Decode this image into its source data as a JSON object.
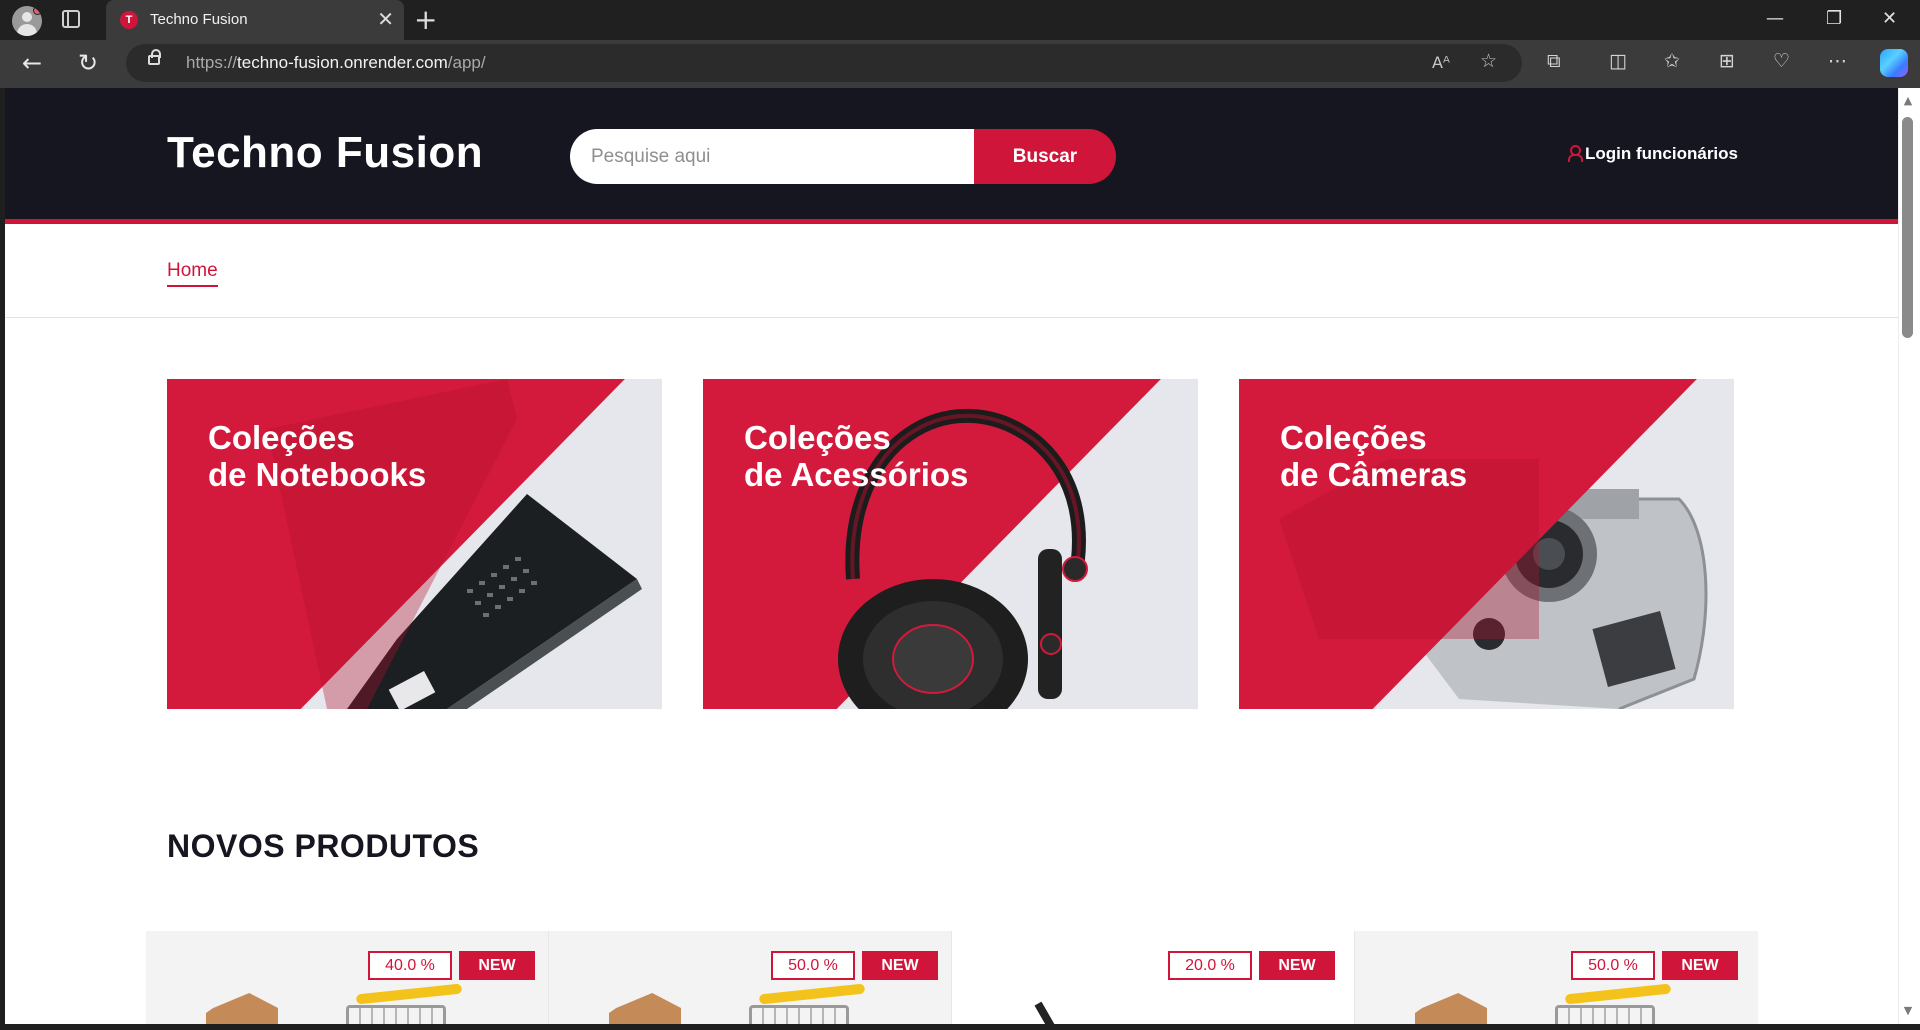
{
  "browser": {
    "tab_title": "Techno Fusion",
    "tab_favicon_letter": "T",
    "url_scheme": "https://",
    "url_host": "techno-fusion.onrender.com",
    "url_path": "/app/",
    "icons": [
      "profile-icon",
      "tab-actions-icon",
      "close-icon",
      "new-tab-icon",
      "minimize-icon",
      "restore-icon",
      "close-window-icon",
      "back-icon",
      "refresh-icon",
      "lock-icon",
      "read-aloud-icon",
      "favorite-icon",
      "extensions-icon",
      "split-screen-icon",
      "favorites-icon",
      "collections-icon",
      "performance-icon",
      "more-icon",
      "copilot-icon"
    ]
  },
  "header": {
    "brand": "Techno Fusion",
    "search_placeholder": "Pesquise aqui",
    "search_button": "Buscar",
    "login_label": "Login funcionários",
    "accent_color": "#d0153a",
    "background_color": "#15161f"
  },
  "nav": {
    "home": "Home"
  },
  "collections": [
    {
      "line1": "Coleções",
      "line2": "de Notebooks",
      "image": "laptop"
    },
    {
      "line1": "Coleções",
      "line2": "de Acessórios",
      "image": "headphones"
    },
    {
      "line1": "Coleções",
      "line2": "de Câmeras",
      "image": "camera"
    }
  ],
  "section": {
    "new_products_title": "NOVOS PRODUTOS"
  },
  "products": [
    {
      "discount": "40.0 %",
      "tag": "NEW",
      "image": "box-and-cart"
    },
    {
      "discount": "50.0 %",
      "tag": "NEW",
      "image": "box-and-cart"
    },
    {
      "discount": "20.0 %",
      "tag": "NEW",
      "image": "device"
    },
    {
      "discount": "50.0 %",
      "tag": "NEW",
      "image": "box-and-cart"
    }
  ]
}
